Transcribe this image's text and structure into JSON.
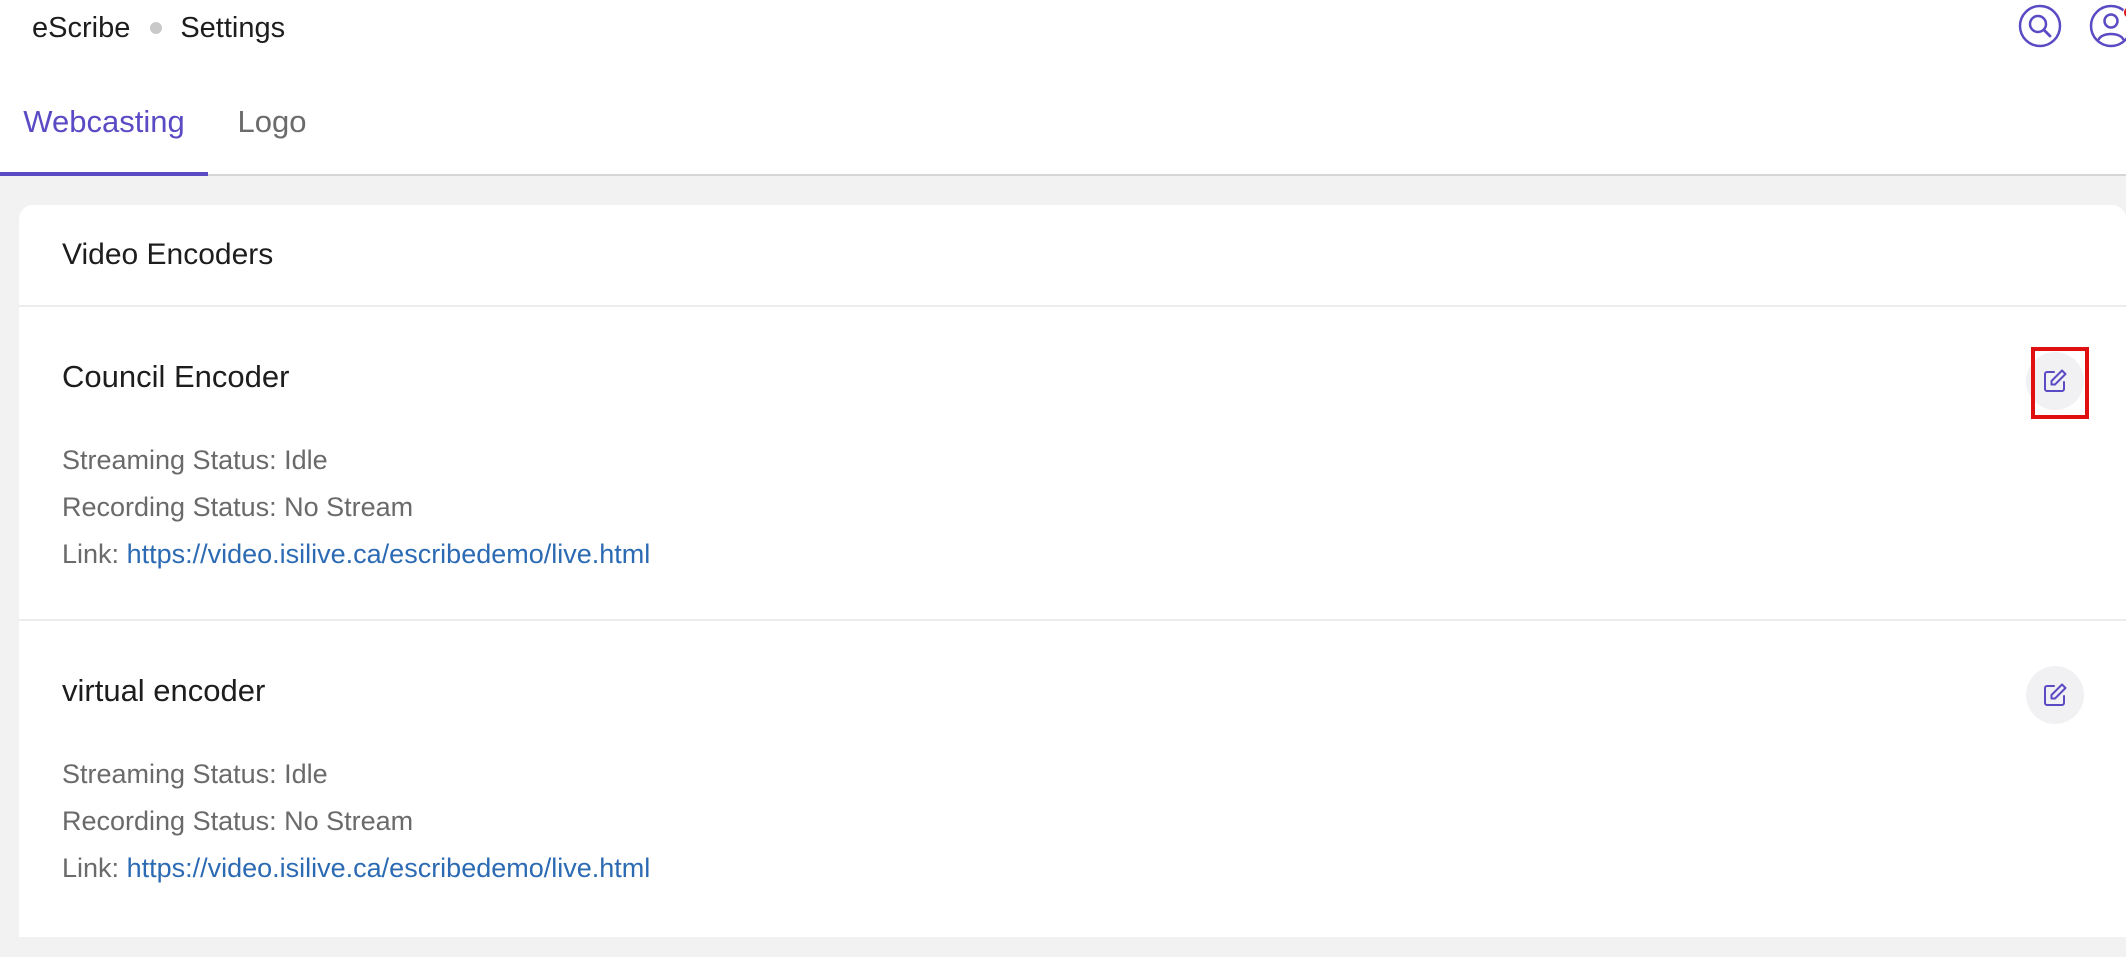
{
  "breadcrumb": {
    "app": "eScribe",
    "page": "Settings"
  },
  "header_icons": {
    "search": "search-icon",
    "user": "user-account-icon",
    "notification_color": "#e0161c"
  },
  "tabs": [
    {
      "label": "Webcasting",
      "active": true
    },
    {
      "label": "Logo",
      "active": false
    }
  ],
  "section": {
    "title": "Video Encoders"
  },
  "encoders": [
    {
      "name": "Council Encoder",
      "streaming_status": "Streaming Status: Idle",
      "recording_status": "Recording Status: No Stream",
      "link_label": "Link:",
      "link_url": "https://video.isilive.ca/escribedemo/live.html",
      "edit_icon": "edit-icon"
    },
    {
      "name": "virtual encoder",
      "streaming_status": "Streaming Status: Idle",
      "recording_status": "Recording Status: No Stream",
      "link_label": "Link:",
      "link_url": "https://video.isilive.ca/escribedemo/live.html",
      "edit_icon": "edit-icon"
    }
  ],
  "colors": {
    "accent": "#5a4bc4",
    "link": "#2c6bb3",
    "highlight": "#e01010",
    "background": "#f2f2f2"
  }
}
